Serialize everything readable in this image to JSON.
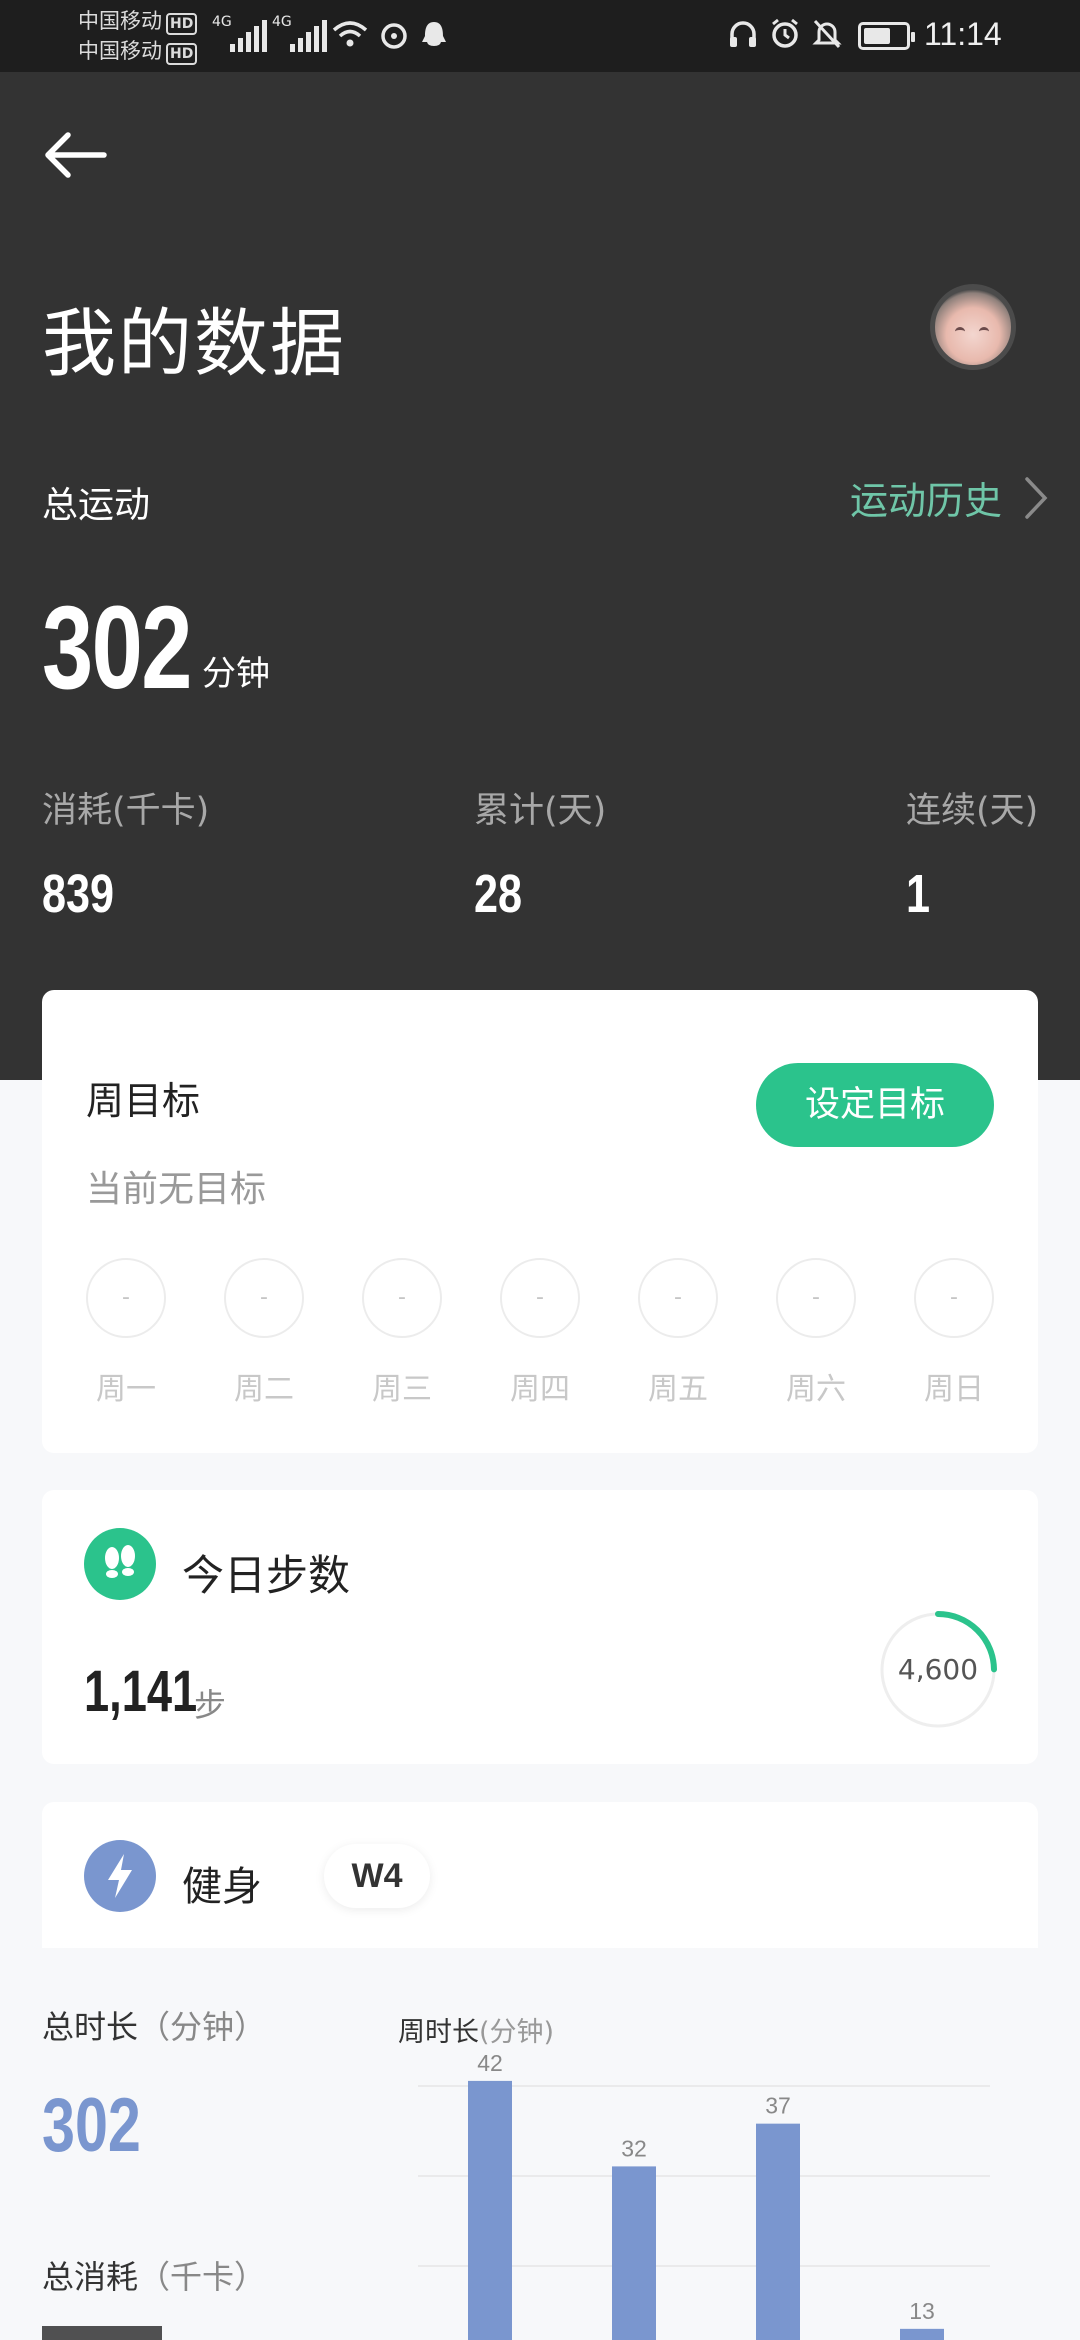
{
  "status_bar": {
    "carrier1": "中国移动",
    "carrier2": "中国移动",
    "hd_badge": "HD",
    "network1": "4G",
    "network2": "4G",
    "time": "11:14"
  },
  "header": {
    "title": "我的数据"
  },
  "summary": {
    "total_label": "总运动",
    "history_link": "运动历史",
    "total_value": "302",
    "total_unit": "分钟",
    "stats": [
      {
        "label": "消耗(千卡)",
        "value": "839"
      },
      {
        "label": "累计(天)",
        "value": "28"
      },
      {
        "label": "连续(天)",
        "value": "1"
      }
    ]
  },
  "weekly_goal": {
    "title": "周目标",
    "subtitle": "当前无目标",
    "set_button": "设定目标",
    "days": [
      {
        "name": "周一",
        "value": "-"
      },
      {
        "name": "周二",
        "value": "-"
      },
      {
        "name": "周三",
        "value": "-"
      },
      {
        "name": "周四",
        "value": "-"
      },
      {
        "name": "周五",
        "value": "-"
      },
      {
        "name": "周六",
        "value": "-"
      },
      {
        "name": "周日",
        "value": "-"
      }
    ]
  },
  "steps": {
    "title": "今日步数",
    "value": "1,141",
    "unit": "步",
    "goal": "4,600",
    "progress": 0.248
  },
  "fitness": {
    "title": "健身",
    "week_badge": "W4",
    "total_duration_label": "总时长",
    "total_duration_unit": "（分钟）",
    "total_duration_value": "302",
    "total_calories_label": "总消耗",
    "total_calories_unit": "（千卡）",
    "chart_title": "周时长",
    "chart_unit": "(分钟)",
    "accent_color": "#7a96cf"
  },
  "chart_data": {
    "type": "bar",
    "values": [
      42,
      32,
      37,
      13
    ],
    "title": "周时长",
    "ylabel": "分钟",
    "grid": true,
    "color": "#7a96cf"
  },
  "colors": {
    "header_bg": "#333333",
    "accent_green": "#2bc38c",
    "link_green": "#6fc6a8",
    "fitness_blue": "#7a96cf"
  }
}
